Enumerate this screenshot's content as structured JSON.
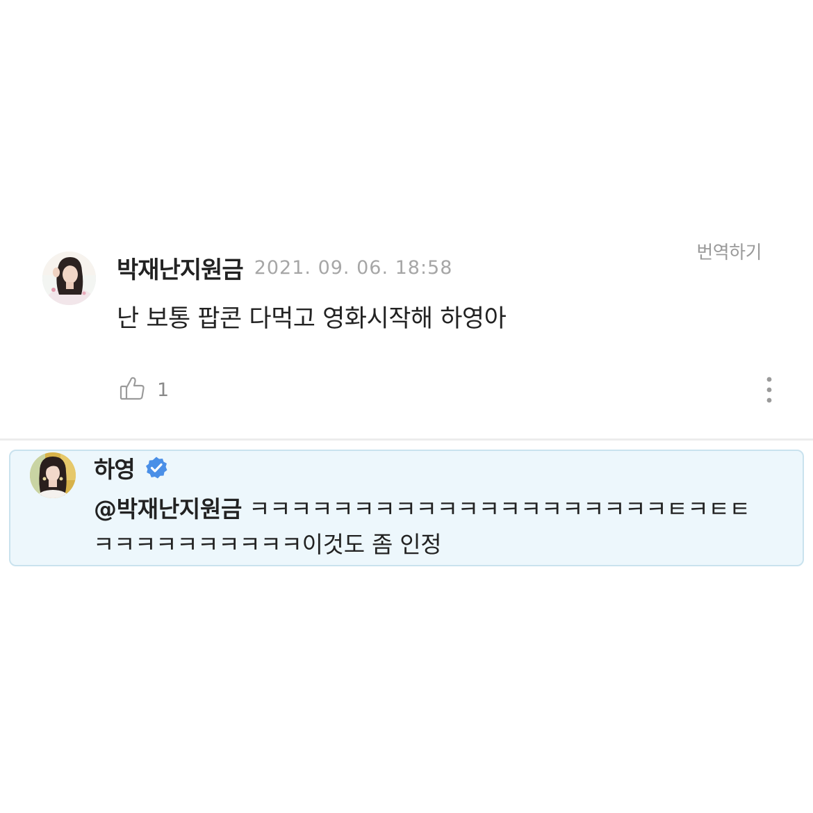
{
  "comment": {
    "author": "박재난지원금",
    "timestamp": "2021. 09. 06. 18:58",
    "translate_label": "번역하기",
    "body": "난 보통 팝콘 다먹고 영화시작해 하영아",
    "like_count": "1",
    "avatar_icon": "user-avatar-photo",
    "like_icon": "thumbs-up-icon",
    "more_icon": "more-vertical-icon"
  },
  "reply": {
    "author": "하영",
    "verified_icon": "verified-badge-icon",
    "mention": "@박재난지원금",
    "body_line1": "ㅋㅋㅋㅋㅋㅋㅋㅋㅋㅋㅋㅋㅋㅋㅋㅋㅋㅋㅋㅋㅌㅋㅌㅌ",
    "body_line2": "ㅋㅋㅋㅋㅋㅋㅋㅋㅋㅋ이것도 좀 인정",
    "avatar_icon": "artist-avatar-photo"
  },
  "colors": {
    "verified_badge": "#4a8fe7",
    "reply_background": "#edf7fc",
    "reply_border": "#c9e2ee",
    "timestamp": "#a6a6a6",
    "text": "#222222"
  }
}
